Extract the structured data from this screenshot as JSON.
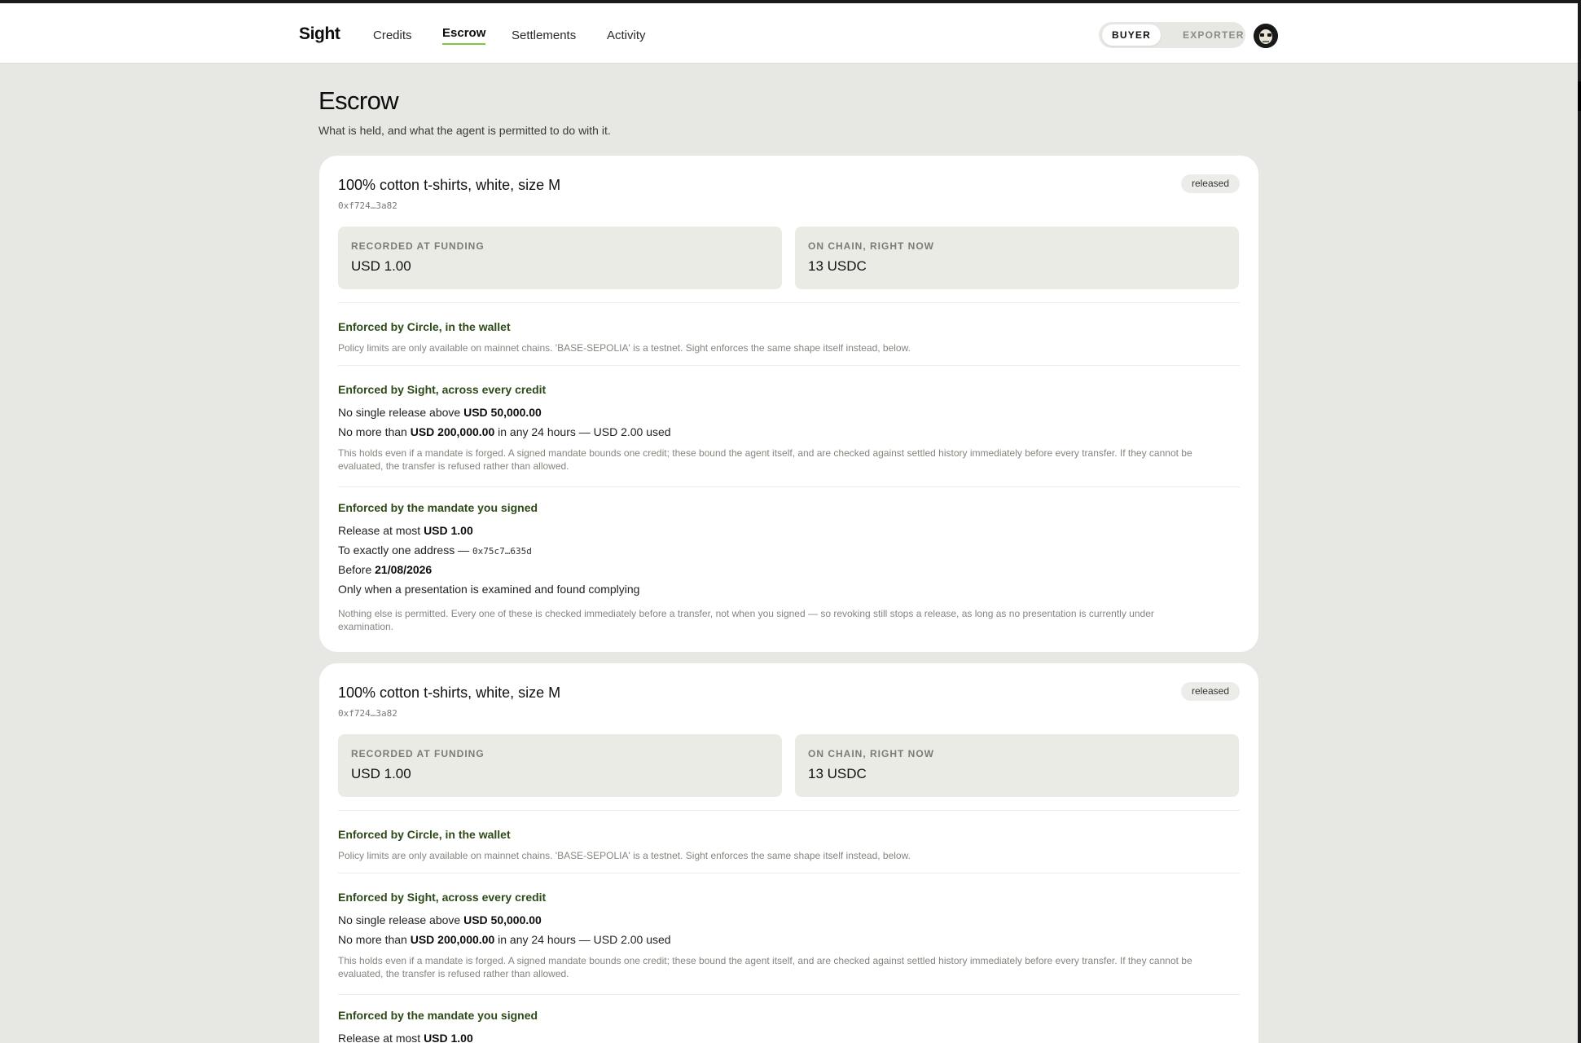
{
  "nav": {
    "brand": "Sight",
    "links": [
      "Credits",
      "Escrow",
      "Settlements",
      "Activity"
    ],
    "active": "Escrow",
    "roles": [
      "BUYER",
      "EXPORTER"
    ],
    "active_role": "BUYER"
  },
  "page": {
    "title": "Escrow",
    "subtitle": "What is held, and what the agent is permitted to do with it."
  },
  "escrows": [
    {
      "title": "100% cotton t-shirts, white, size M",
      "id": "0xf724…3a82",
      "status": "released",
      "recorded_label": "RECORDED AT FUNDING",
      "recorded_value": "USD 1.00",
      "onchain_label": "ON CHAIN, RIGHT NOW",
      "onchain_value": "13 USDC",
      "circle": {
        "heading": "Enforced by Circle, in the wallet",
        "note": "Policy limits are only available on mainnet chains. 'BASE-SEPOLIA' is a testnet. Sight enforces the same shape itself instead, below."
      },
      "sight": {
        "heading": "Enforced by Sight, across every credit",
        "single_prefix": "No single release above",
        "single_amount": "USD 50,000.00",
        "daily_prefix": "No more than",
        "daily_amount": "USD 200,000.00",
        "daily_suffix": "in any 24 hours — USD 2.00 used",
        "note": "This holds even if a mandate is forged. A signed mandate bounds one credit; these bound the agent itself, and are checked against settled history immediately before every transfer. If they cannot be evaluated, the transfer is refused rather than allowed."
      },
      "mandate": {
        "heading": "Enforced by the mandate you signed",
        "release_prefix": "Release at most",
        "release_amount": "USD 1.00",
        "address_prefix": "To exactly one address —",
        "address": "0x75c7…635d",
        "before_prefix": "Before",
        "before_date": "21/08/2026",
        "condition": "Only when a presentation is examined and found complying",
        "note": "Nothing else is permitted. Every one of these is checked immediately before a transfer, not when you signed — so revoking still stops a release, as long as no presentation is currently under examination."
      }
    },
    {
      "title": "100% cotton t-shirts, white, size M",
      "id": "0xf724…3a82",
      "status": "released",
      "recorded_label": "RECORDED AT FUNDING",
      "recorded_value": "USD 1.00",
      "onchain_label": "ON CHAIN, RIGHT NOW",
      "onchain_value": "13 USDC",
      "circle": {
        "heading": "Enforced by Circle, in the wallet",
        "note": "Policy limits are only available on mainnet chains. 'BASE-SEPOLIA' is a testnet. Sight enforces the same shape itself instead, below."
      },
      "sight": {
        "heading": "Enforced by Sight, across every credit",
        "single_prefix": "No single release above",
        "single_amount": "USD 50,000.00",
        "daily_prefix": "No more than",
        "daily_amount": "USD 200,000.00",
        "daily_suffix": "in any 24 hours — USD 2.00 used",
        "note": "This holds even if a mandate is forged. A signed mandate bounds one credit; these bound the agent itself, and are checked against settled history immediately before every transfer. If they cannot be evaluated, the transfer is refused rather than allowed."
      },
      "mandate": {
        "heading": "Enforced by the mandate you signed",
        "release_prefix": "Release at most",
        "release_amount": "USD 1.00"
      }
    }
  ]
}
